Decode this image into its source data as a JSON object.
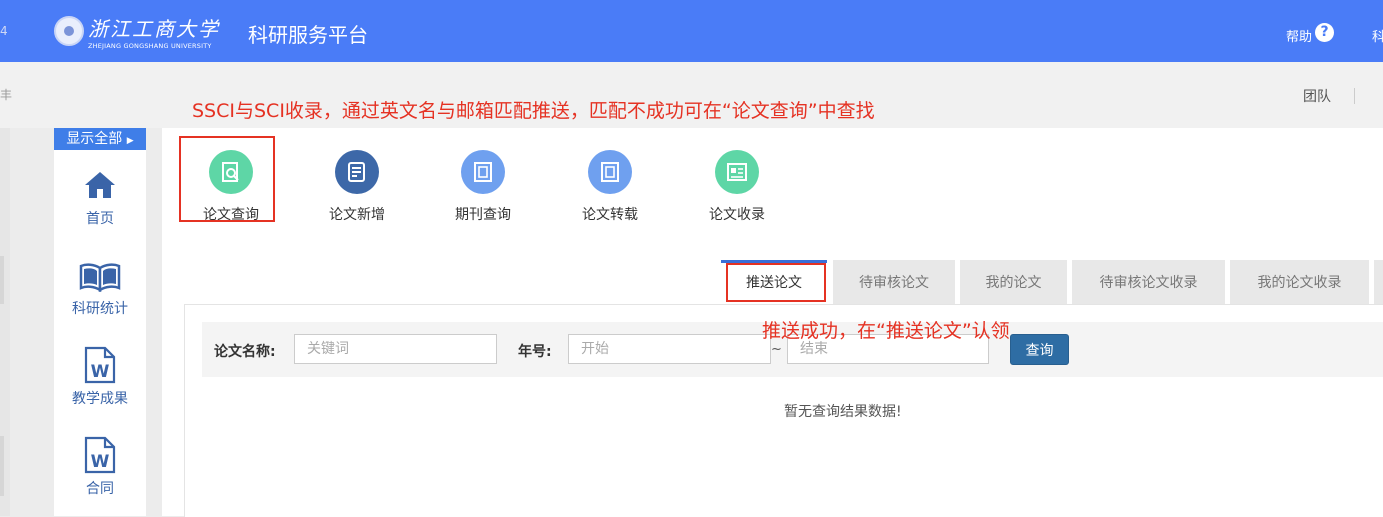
{
  "header": {
    "university_cn": "浙江工商大学",
    "university_en": "ZHEJIANG GONGSHANG UNIVERSITY",
    "platform": "科研服务平台",
    "help": "帮助",
    "help_icon": "?",
    "right_fragment": "科",
    "edge_left_fragments": [
      "4",
      "丰"
    ]
  },
  "subheader": {
    "team": "团队"
  },
  "annotations": {
    "top": "SSCI与SCI收录，通过英文名与邮箱匹配推送，匹配不成功可在“论文查询”中查找",
    "middle": "推送成功，在“推送论文”认领"
  },
  "sidebar": {
    "show_all": "显示全部",
    "items": [
      {
        "label": "首页",
        "icon": "home-icon"
      },
      {
        "label": "科研统计",
        "icon": "book-icon"
      },
      {
        "label": "教学成果",
        "icon": "word-document-icon"
      },
      {
        "label": "合同",
        "icon": "word-document-icon"
      }
    ]
  },
  "toolbar": {
    "items": [
      {
        "label": "论文查询",
        "icon": "paper-search-icon",
        "color": "#5ed6a6"
      },
      {
        "label": "论文新增",
        "icon": "paper-add-icon",
        "color": "#3d68a8"
      },
      {
        "label": "期刊查询",
        "icon": "journal-icon",
        "color": "#6fa0ef"
      },
      {
        "label": "论文转载",
        "icon": "journal-icon",
        "color": "#6fa0ef"
      },
      {
        "label": "论文收录",
        "icon": "newspaper-icon",
        "color": "#5ed6a6"
      }
    ]
  },
  "tabs": [
    {
      "label": "推送论文",
      "active": true
    },
    {
      "label": "待审核论文",
      "active": false
    },
    {
      "label": "我的论文",
      "active": false
    },
    {
      "label": "待审核论文收录",
      "active": false
    },
    {
      "label": "我的论文收录",
      "active": false
    }
  ],
  "filters": {
    "title_label": "论文名称:",
    "title_placeholder": "关键词",
    "year_label": "年号:",
    "year_start_placeholder": "开始",
    "range_separator": "~",
    "year_end_placeholder": "结束",
    "query_button": "查询"
  },
  "results": {
    "empty_message": "暂无查询结果数据!"
  },
  "colors": {
    "header_blue": "#4a7cf7",
    "annotation_red": "#e53223",
    "button_blue": "#2e6da4",
    "tab_active_border": "#3a6fd8"
  }
}
